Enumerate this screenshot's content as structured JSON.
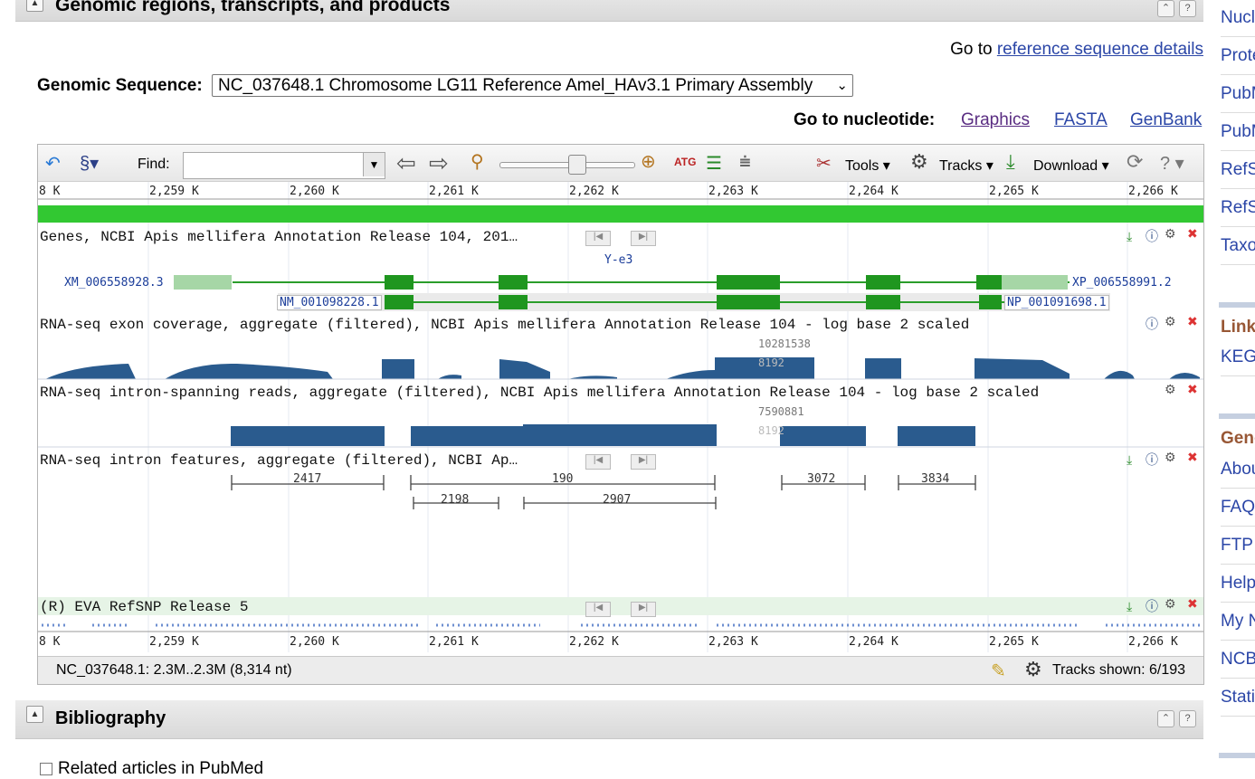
{
  "header": {
    "title": "Genomic regions, transcripts, and products"
  },
  "goto_ref": {
    "prefix": "Go to",
    "link": "reference sequence details"
  },
  "genomic_sequence": {
    "label": "Genomic Sequence:",
    "selected": "NC_037648.1 Chromosome LG11 Reference Amel_HAv3.1 Primary Assembly"
  },
  "goto_nucleotide": {
    "label": "Go to nucleotide:",
    "links": [
      "Graphics",
      "FASTA",
      "GenBank"
    ]
  },
  "toolbar": {
    "find_label": "Find:",
    "find_value": "",
    "tools": "Tools",
    "tracks": "Tracks",
    "download": "Download"
  },
  "ruler": {
    "labels": [
      "8 K",
      "2,259 K",
      "2,260 K",
      "2,261 K",
      "2,262 K",
      "2,263 K",
      "2,264 K",
      "2,265 K",
      "2,266 K"
    ]
  },
  "tracks": {
    "genes": {
      "title": "Genes, NCBI Apis mellifera Annotation Release 104, 201…",
      "gene_name": "Y-e3",
      "transcript1": "XM_006558928.3",
      "product1": "XP_006558991.2",
      "transcript2": "NM_001098228.1",
      "product2": "NP_001091698.1"
    },
    "exon_cov": {
      "title": "RNA-seq exon coverage, aggregate (filtered), NCBI Apis mellifera Annotation Release 104 - log base 2 scaled",
      "max_label": "10281538",
      "sub_label": "8192"
    },
    "intron_span": {
      "title": "RNA-seq intron-spanning reads, aggregate (filtered), NCBI Apis mellifera Annotation Release 104 - log base 2 scaled",
      "max_label": "7590881",
      "sub_label": "8192"
    },
    "intron_feat": {
      "title": "RNA-seq intron features, aggregate (filtered), NCBI Ap…",
      "counts": [
        "2417",
        "190",
        "2198",
        "2907",
        "3072",
        "3834"
      ]
    },
    "snp": {
      "title": "(R)  EVA RefSNP Release 5"
    }
  },
  "status": {
    "range": "NC_037648.1: 2.3M..2.3M (8,314 nt)",
    "tracks_shown": "Tracks shown: 6/193"
  },
  "bibliography": {
    "title": "Bibliography",
    "related_articles": "Related articles in PubMed"
  },
  "sidebar": {
    "items": [
      "Nucleotide",
      "Protein",
      "PubMed",
      "PubMed (Weighted)",
      "RefSeq",
      "RefSeq Genomic",
      "Taxonomy"
    ],
    "links_head": "Links",
    "links": [
      "KEGG"
    ],
    "gen_head": "General",
    "gen_items": [
      "About",
      "FAQ",
      "FTP",
      "Help",
      "My NCBI",
      "NCBI",
      "Statistics"
    ]
  },
  "colors": {
    "gene_green": "#2a9d2a",
    "coverage_blue": "#2a5b8e",
    "link_blue": "#2b46a7"
  }
}
